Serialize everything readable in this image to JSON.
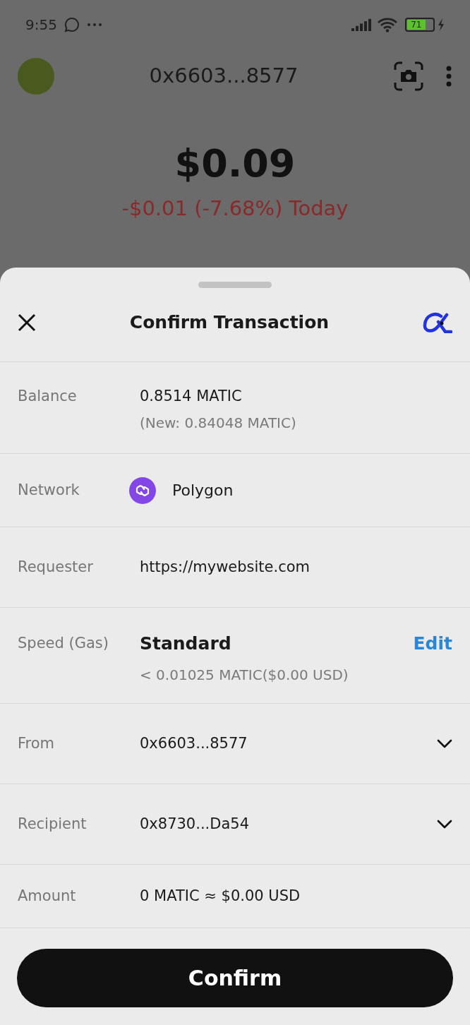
{
  "status_bar": {
    "time": "9:55",
    "battery": "71"
  },
  "header": {
    "address": "0x6603...8577"
  },
  "balance": {
    "total": "$0.09",
    "change": "-$0.01 (-7.68%) Today"
  },
  "sheet": {
    "title": "Confirm Transaction",
    "rows": [
      {
        "kind": "balance",
        "label": "Balance",
        "value": "0.8514 MATIC",
        "note": "(New: 0.84048 MATIC)"
      },
      {
        "kind": "network",
        "label": "Network",
        "value": "Polygon"
      },
      {
        "kind": "text",
        "label": "Requester",
        "value": "https://mywebsite.com"
      },
      {
        "kind": "gas",
        "label": "Speed (Gas)",
        "value": "Standard",
        "note": "< 0.01025 MATIC($0.00 USD)",
        "action": "Edit"
      },
      {
        "kind": "dropdown",
        "label": "From",
        "value": "0x6603...8577",
        "expanded": false
      },
      {
        "kind": "dropdown",
        "label": "Recipient",
        "value": "0x8730...Da54",
        "expanded": false
      },
      {
        "kind": "text",
        "label": "Amount",
        "value": "0 MATIC ≈ $0.00 USD"
      }
    ],
    "confirm": "Confirm"
  }
}
